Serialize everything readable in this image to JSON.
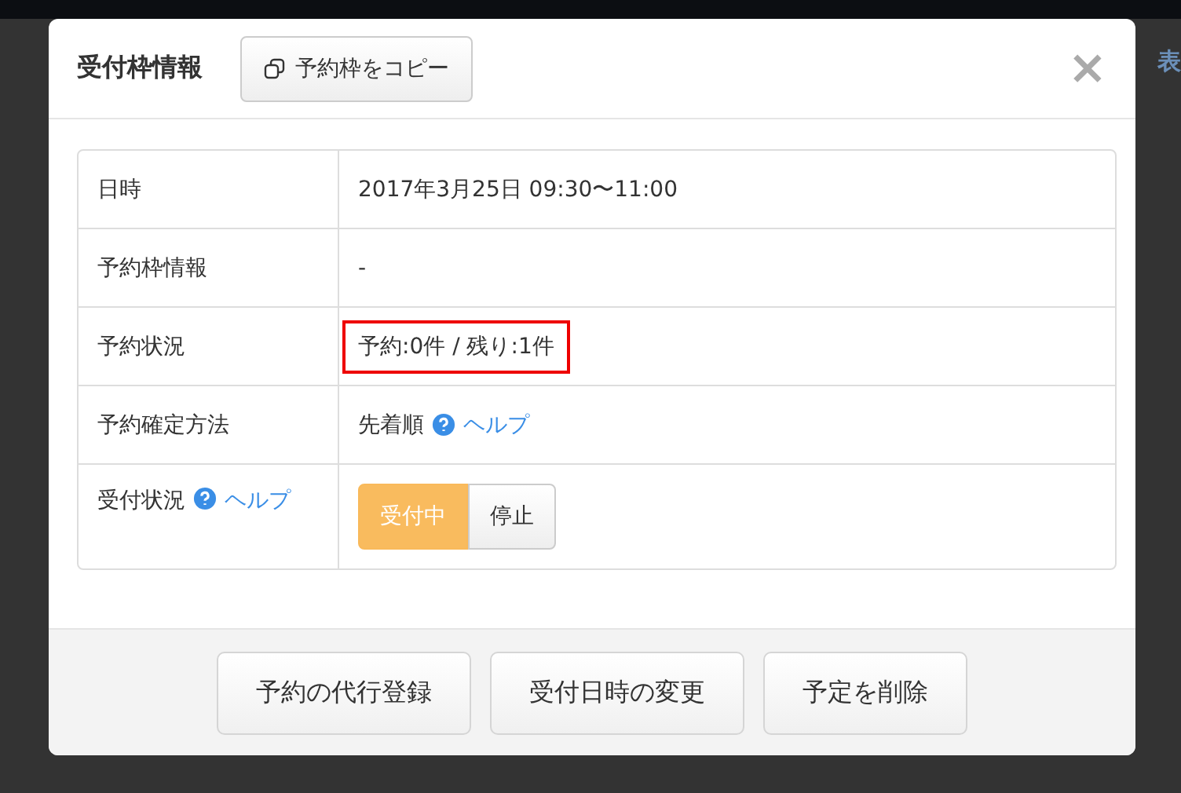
{
  "background": {
    "fragment": "表"
  },
  "dialog": {
    "title": "受付枠情報",
    "copy_button": "予約枠をコピー",
    "close": "×",
    "rows": [
      {
        "label": "日時",
        "kind": "text",
        "value": "2017年3月25日 09:30〜11:00"
      },
      {
        "label": "予約枠情報",
        "kind": "text",
        "value": "-"
      },
      {
        "label": "予約状況",
        "kind": "highlight",
        "value": "予約:0件 / 残り:1件"
      },
      {
        "label": "予約確定方法",
        "kind": "help",
        "value": "先着順",
        "help": "ヘルプ"
      },
      {
        "label": "受付状況",
        "label_help": "ヘルプ",
        "kind": "toggle",
        "options": [
          {
            "label": "受付中",
            "selected": true
          },
          {
            "label": "停止",
            "selected": false
          }
        ]
      }
    ],
    "buttons": [
      "予約の代行登録",
      "受付日時の変更",
      "予定を削除"
    ]
  }
}
